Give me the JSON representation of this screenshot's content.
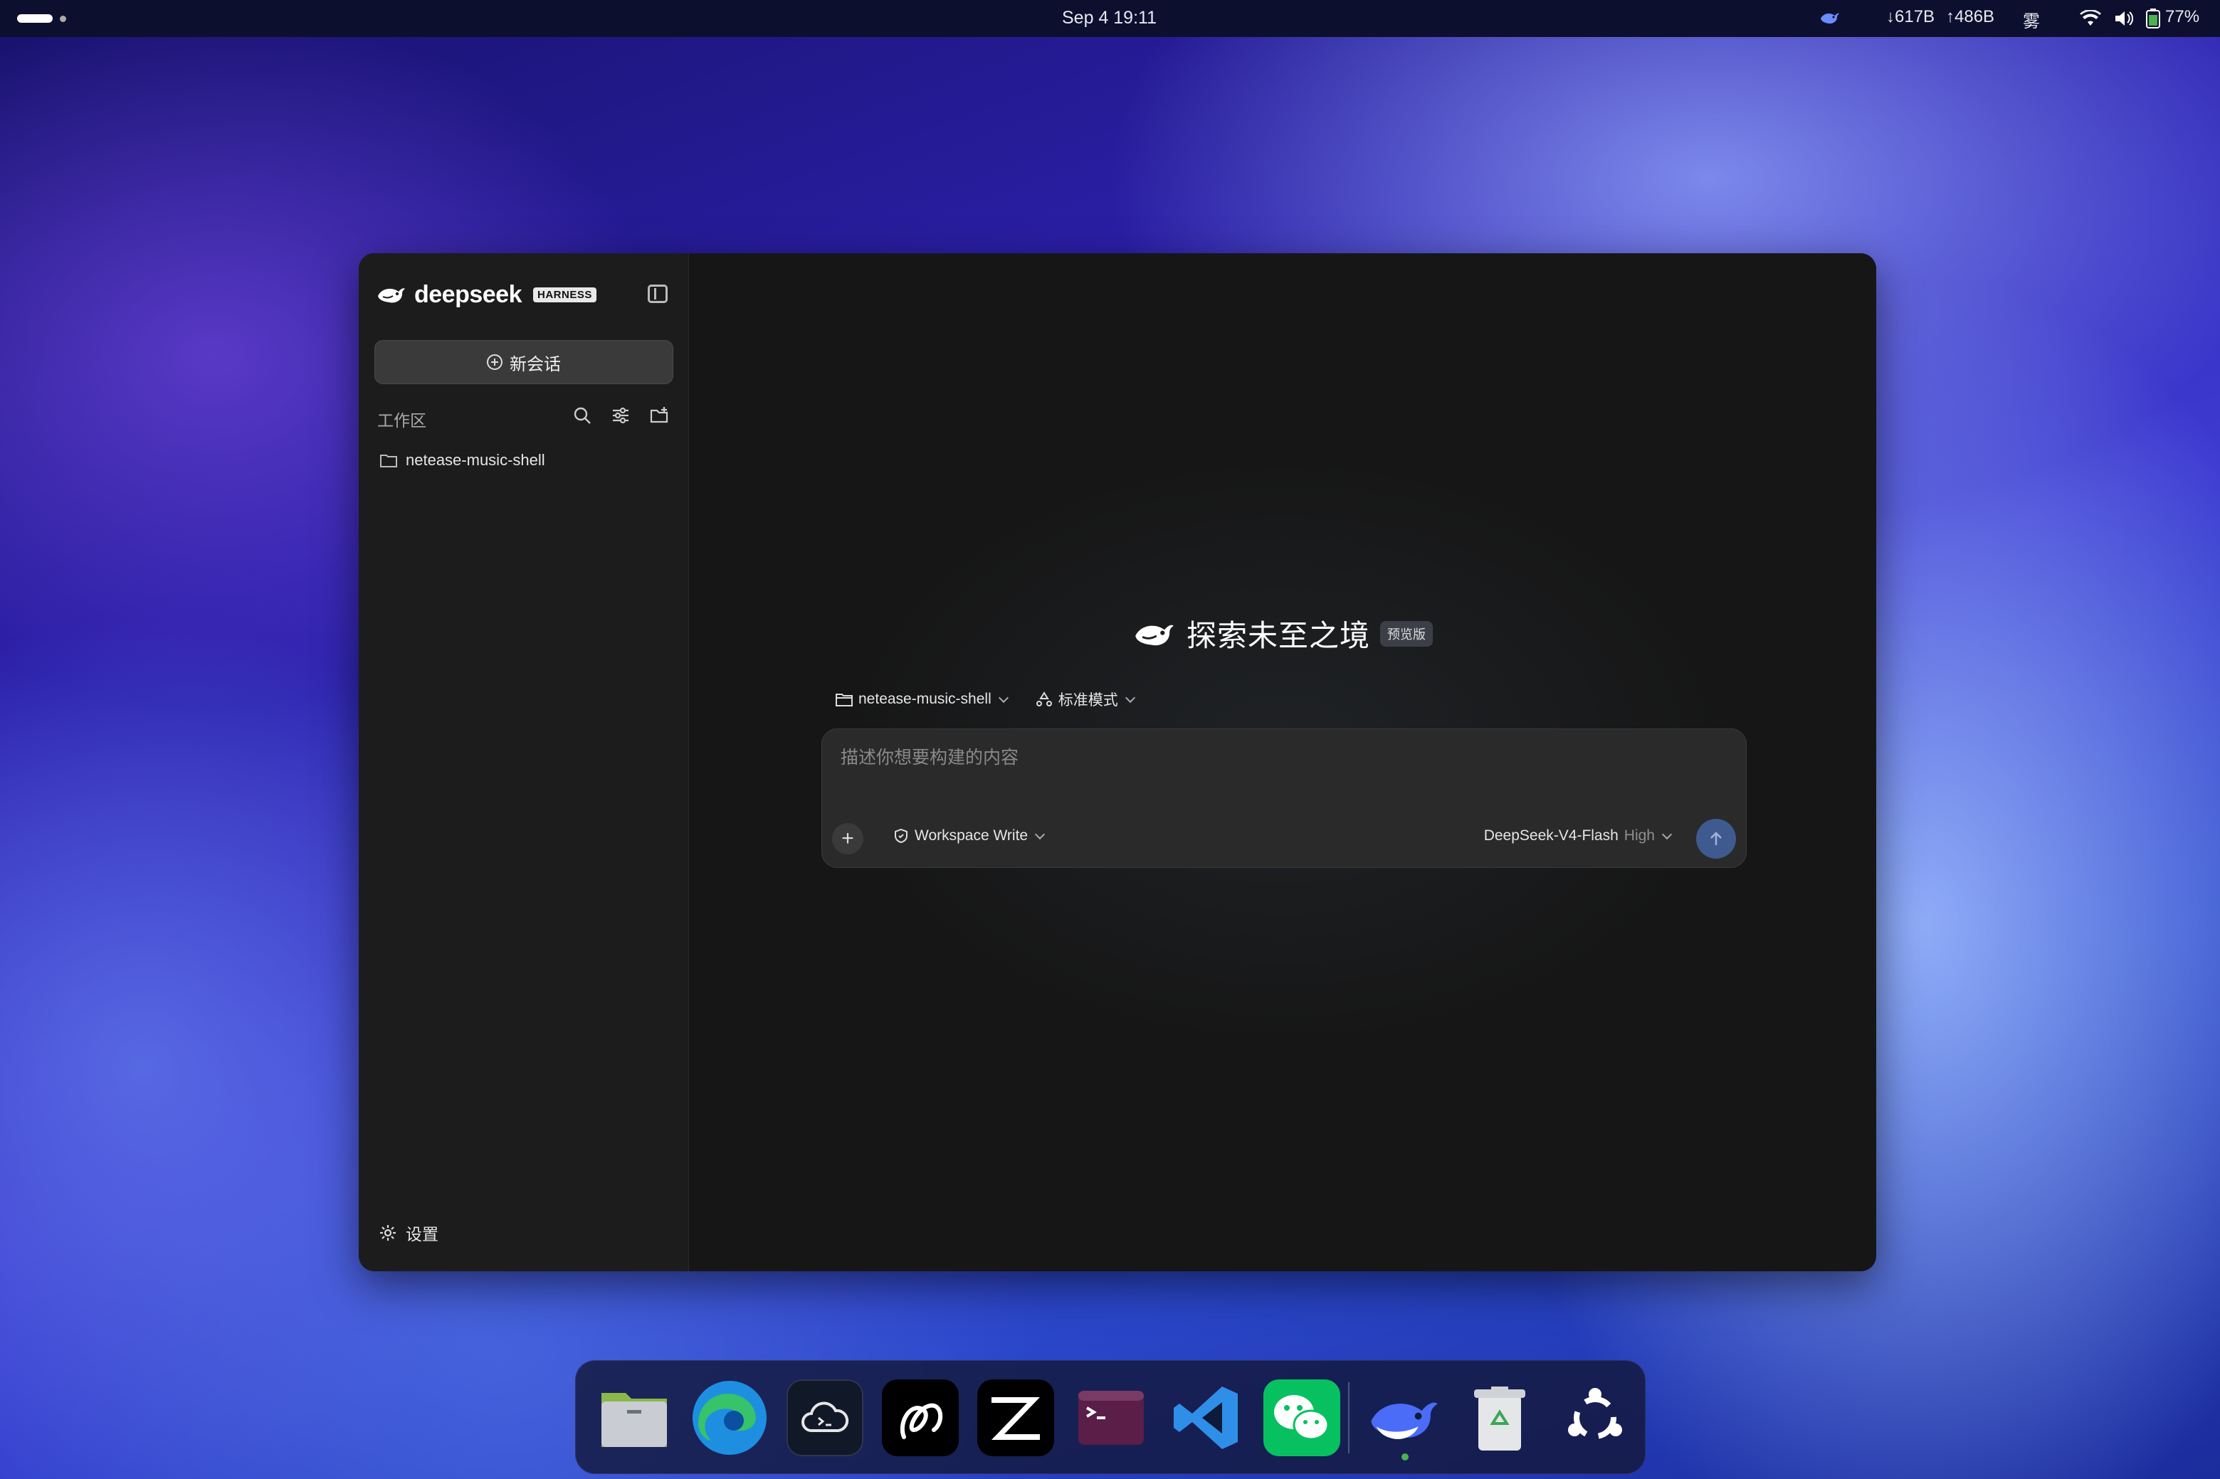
{
  "topbar": {
    "clock": "Sep 4  19:11",
    "net_down": "↓617B",
    "net_up": "↑486B",
    "weather": "雾",
    "battery": "77%"
  },
  "sidebar": {
    "brand": "deepseek",
    "badge": "HARNESS",
    "new_chat": "新会话",
    "workspace_label": "工作区",
    "projects": [
      "netease-music-shell"
    ],
    "settings": "设置"
  },
  "main": {
    "title": "探索未至之境",
    "badge": "预览版",
    "project_selector": "netease-music-shell",
    "mode_selector": "标准模式",
    "composer": {
      "placeholder": "描述你想要构建的内容",
      "value": "",
      "permission": "Workspace Write",
      "model": "DeepSeek-V4-Flash",
      "effort": "High"
    }
  },
  "dock": {
    "apps": [
      "files-icon",
      "edge-icon",
      "cloud-terminal-icon",
      "ink-icon",
      "zed-icon",
      "terminal-icon",
      "vscode-icon",
      "wechat-icon",
      "deepseek-icon",
      "trash-icon",
      "ubuntu-icon"
    ]
  },
  "colors": {
    "window_bg": "#161616",
    "sidebar_bg": "#1c1c1c",
    "send_button": "#3f5a8f",
    "wechat_green": "#07c160",
    "vscode_blue": "#2f8fe8"
  }
}
